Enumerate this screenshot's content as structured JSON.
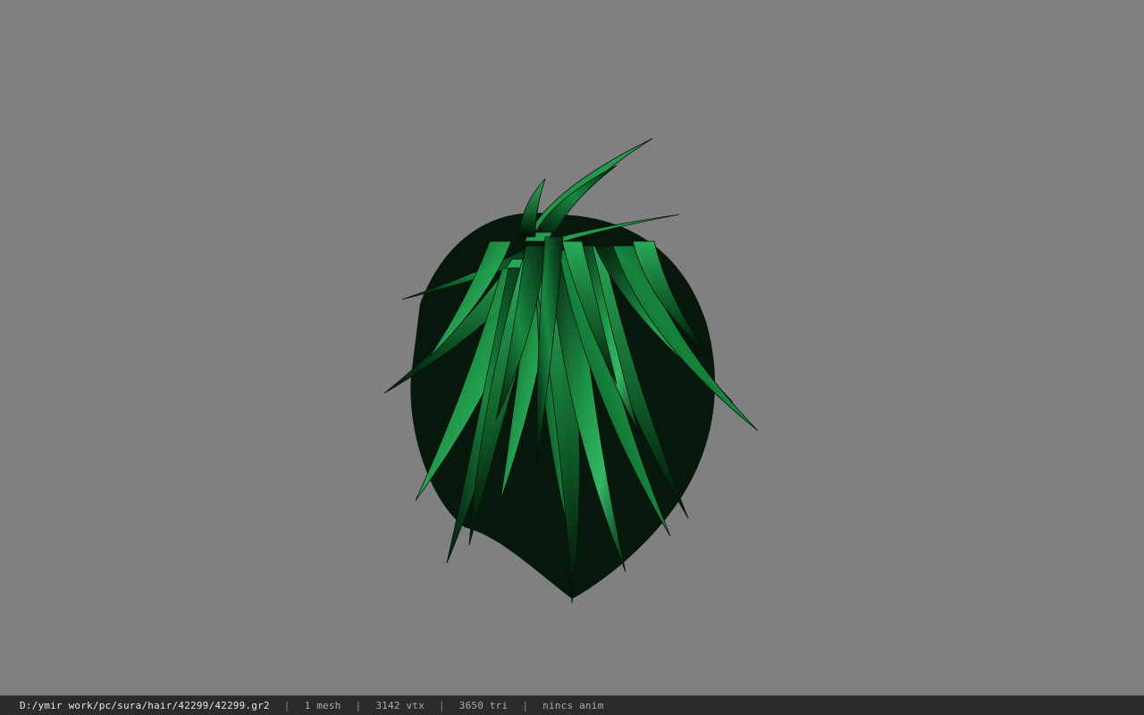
{
  "viewport": {
    "background": "#808080",
    "model": "hair-mesh",
    "hair_colors": [
      "#1f9a4a",
      "#0f5a28",
      "#36c06a",
      "#041a0c"
    ]
  },
  "status_bar": {
    "file_path": "D:/ymir work/pc/sura/hair/42299/42299.gr2",
    "separator": "|",
    "mesh_count": "1 mesh",
    "vertex_count": "3142 vtx",
    "triangle_count": "3650 tri",
    "anim_status": "nincs anim"
  }
}
